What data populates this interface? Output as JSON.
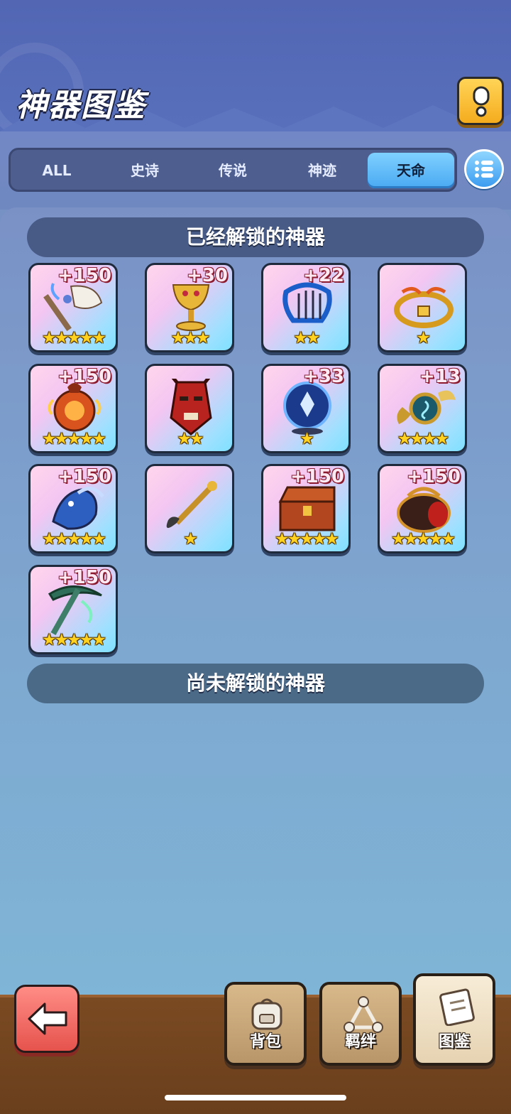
{
  "header": {
    "title": "神器图鉴",
    "help_icon": "exclamation-icon"
  },
  "tabs": [
    {
      "label": "ALL",
      "active": false
    },
    {
      "label": "史诗",
      "active": false
    },
    {
      "label": "传说",
      "active": false
    },
    {
      "label": "神迹",
      "active": false
    },
    {
      "label": "天命",
      "active": true
    }
  ],
  "sections": {
    "unlocked_title": "已经解锁的神器",
    "locked_title": "尚未解锁的神器"
  },
  "artifacts": [
    {
      "name": "axe-artifact",
      "bonus": "+150",
      "stars": "★★★★★",
      "star_count": 5
    },
    {
      "name": "golden-chalice-artifact",
      "bonus": "+30",
      "stars": "★★★",
      "star_count": 3
    },
    {
      "name": "harp-artifact",
      "bonus": "+22",
      "stars": "★★",
      "star_count": 2
    },
    {
      "name": "golden-crown-artifact",
      "bonus": "",
      "stars": "★",
      "star_count": 1
    },
    {
      "name": "fire-orb-artifact",
      "bonus": "+150",
      "stars": "★★★★★",
      "star_count": 5
    },
    {
      "name": "demon-mask-artifact",
      "bonus": "",
      "stars": "★★",
      "star_count": 2
    },
    {
      "name": "crystal-ball-artifact",
      "bonus": "+33",
      "stars": "★",
      "star_count": 1
    },
    {
      "name": "winged-emblem-artifact",
      "bonus": "+13",
      "stars": "★★★★",
      "star_count": 4
    },
    {
      "name": "dragon-artifact",
      "bonus": "+150",
      "stars": "★★★★★",
      "star_count": 5
    },
    {
      "name": "golden-brush-artifact",
      "bonus": "",
      "stars": "★",
      "star_count": 1
    },
    {
      "name": "treasure-chest-artifact",
      "bonus": "+150",
      "stars": "★★★★★",
      "star_count": 5
    },
    {
      "name": "demon-cauldron-artifact",
      "bonus": "+150",
      "stars": "★★★★★",
      "star_count": 5
    },
    {
      "name": "jade-pickaxe-artifact",
      "bonus": "+150",
      "stars": "★★★★★",
      "star_count": 5
    }
  ],
  "bottom_nav": {
    "bag_label": "背包",
    "bond_label": "羁绊",
    "codex_label": "图鉴"
  },
  "colors": {
    "accent_tab": "#4aa9f2",
    "back_button": "#e6534d",
    "star": "#ffd21f",
    "bonus_outline": "#8b1a2f"
  }
}
